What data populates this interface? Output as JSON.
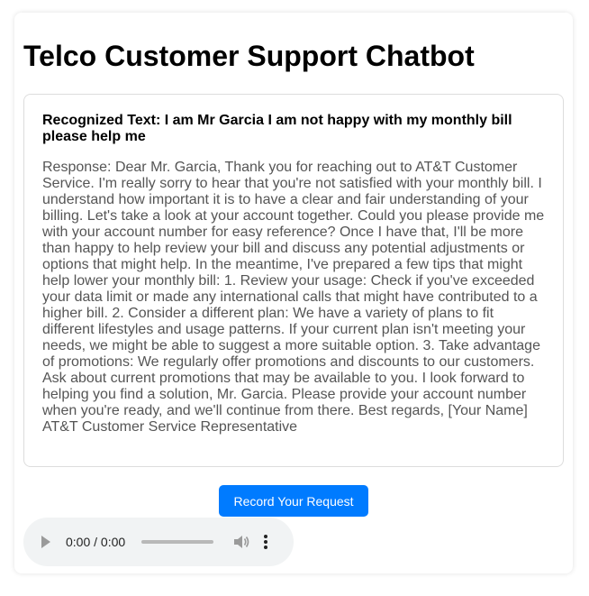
{
  "page": {
    "title": "Telco Customer Support Chatbot"
  },
  "transcript": {
    "recognized_text": "Recognized Text: I am Mr Garcia I am not happy with my monthly bill please help me",
    "response_text": "Response: Dear Mr. Garcia, Thank you for reaching out to AT&T Customer Service. I'm really sorry to hear that you're not satisfied with your monthly bill. I understand how important it is to have a clear and fair understanding of your billing. Let's take a look at your account together. Could you please provide me with your account number for easy reference? Once I have that, I'll be more than happy to help review your bill and discuss any potential adjustments or options that might help. In the meantime, I've prepared a few tips that might help lower your monthly bill: 1. Review your usage: Check if you've exceeded your data limit or made any international calls that might have contributed to a higher bill. 2. Consider a different plan: We have a variety of plans to fit different lifestyles and usage patterns. If your current plan isn't meeting your needs, we might be able to suggest a more suitable option. 3. Take advantage of promotions: We regularly offer promotions and discounts to our customers. Ask about current promotions that may be available to you. I look forward to helping you find a solution, Mr. Garcia. Please provide your account number when you're ready, and we'll continue from there. Best regards, [Your Name] AT&T Customer Service Representative"
  },
  "controls": {
    "record_label": "Record Your Request"
  },
  "audio": {
    "time_display": "0:00 / 0:00",
    "play_icon": "play-icon",
    "volume_icon": "volume-icon",
    "menu_icon": "more-vert-icon",
    "progress": 0
  },
  "colors": {
    "accent": "#007bff",
    "response_text": "#555555",
    "border": "#dddddd",
    "audio_bg": "#f1f3f4"
  }
}
